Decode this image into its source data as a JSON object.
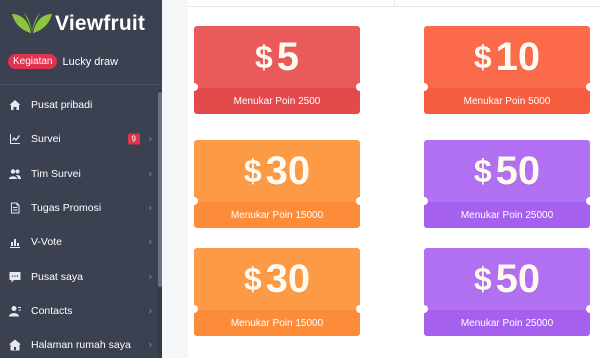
{
  "brand": {
    "name": "Viewfruit"
  },
  "promo": {
    "badge": "Kegiatan",
    "label": "Lucky draw"
  },
  "menu": [
    {
      "label": "Pusat pribadi",
      "icon": "home-icon"
    },
    {
      "label": "Survei",
      "icon": "chart-icon",
      "count": "9"
    },
    {
      "label": "Tim Survei",
      "icon": "users-icon"
    },
    {
      "label": "Tugas Promosi",
      "icon": "document-icon"
    },
    {
      "label": "V-Vote",
      "icon": "bar-chart-icon"
    },
    {
      "label": "Pusat saya",
      "icon": "message-icon"
    },
    {
      "label": "Contacts",
      "icon": "contacts-icon"
    },
    {
      "label": "Halaman rumah saya",
      "icon": "house-icon"
    }
  ],
  "coupons": [
    {
      "symbol": "$",
      "amount": "5",
      "label": "Menukar Poin 2500"
    },
    {
      "symbol": "$",
      "amount": "10",
      "label": "Menukar Poin 5000"
    },
    {
      "symbol": "$",
      "amount": "30",
      "label": "Menukar Poin 15000"
    },
    {
      "symbol": "$",
      "amount": "50",
      "label": "Menukar Poin 25000"
    },
    {
      "symbol": "$",
      "amount": "30",
      "label": "Menukar Poin 15000"
    },
    {
      "symbol": "$",
      "amount": "50",
      "label": "Menukar Poin 25000"
    }
  ],
  "colors": {
    "sidebar": "#3b4150",
    "accent": "#e0334e",
    "coupon_red": "#ea5a5a",
    "coupon_coral": "#fb6a4a",
    "coupon_orange": "#fd9a45",
    "coupon_purple": "#b170f2"
  }
}
